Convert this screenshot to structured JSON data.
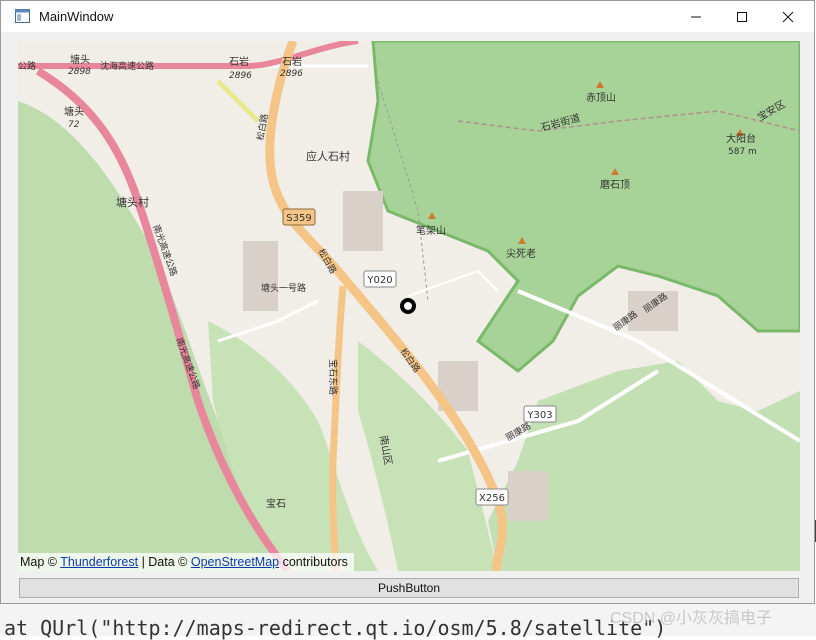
{
  "window": {
    "title": "MainWindow"
  },
  "map": {
    "attribution": {
      "prefix": "Map ©",
      "provider_link": "Thunderforest",
      "data_text": "| Data ©",
      "data_link": "OpenStreetMap",
      "suffix": "contributors"
    },
    "labels": {
      "tangtou_top": "塘头",
      "tangtou_top_num": "2898",
      "shenhai": "沈海高速公路",
      "shiyan1": "石岩",
      "shiyan1_num": "2896",
      "shiyan2": "石岩",
      "shiyan2_num": "2896",
      "gonglu": "公路",
      "tangtou_left": "塘头",
      "tangtou_left_num": "72",
      "songbai_top": "松白路",
      "yingren": "应人石村",
      "tangtoucun": "塘头村",
      "s359": "S359",
      "nanguang": "南光高速公路",
      "nanguang2": "南光高速公路",
      "y020": "Y020",
      "tangtou_road": "塘头一号路",
      "baoshilu": "宝石东路",
      "songbai_mid": "松白路",
      "songbai_low": "松白路",
      "y303": "Y303",
      "lilan": "丽康路",
      "lilan2": "丽康路",
      "x256": "X256",
      "baoshi": "宝石",
      "bijia": "笔架山",
      "jianshi": "尖死老",
      "chiding": "赤顶山",
      "moshi": "磨石顶",
      "shiyanjie": "石岩街道",
      "dayangtai": "大阳台",
      "dayangtai_h": "587 m",
      "baoan": "宝安区",
      "nanshan": "南山区",
      "lichang": "丽康路"
    }
  },
  "push_button": {
    "label": "PushButton"
  },
  "background": {
    "code_line": "at QUrl(\"http://maps-redirect.qt.io/osm/5.8/satellite\")",
    "watermark": "CSDN @小灰灰搞电子"
  }
}
